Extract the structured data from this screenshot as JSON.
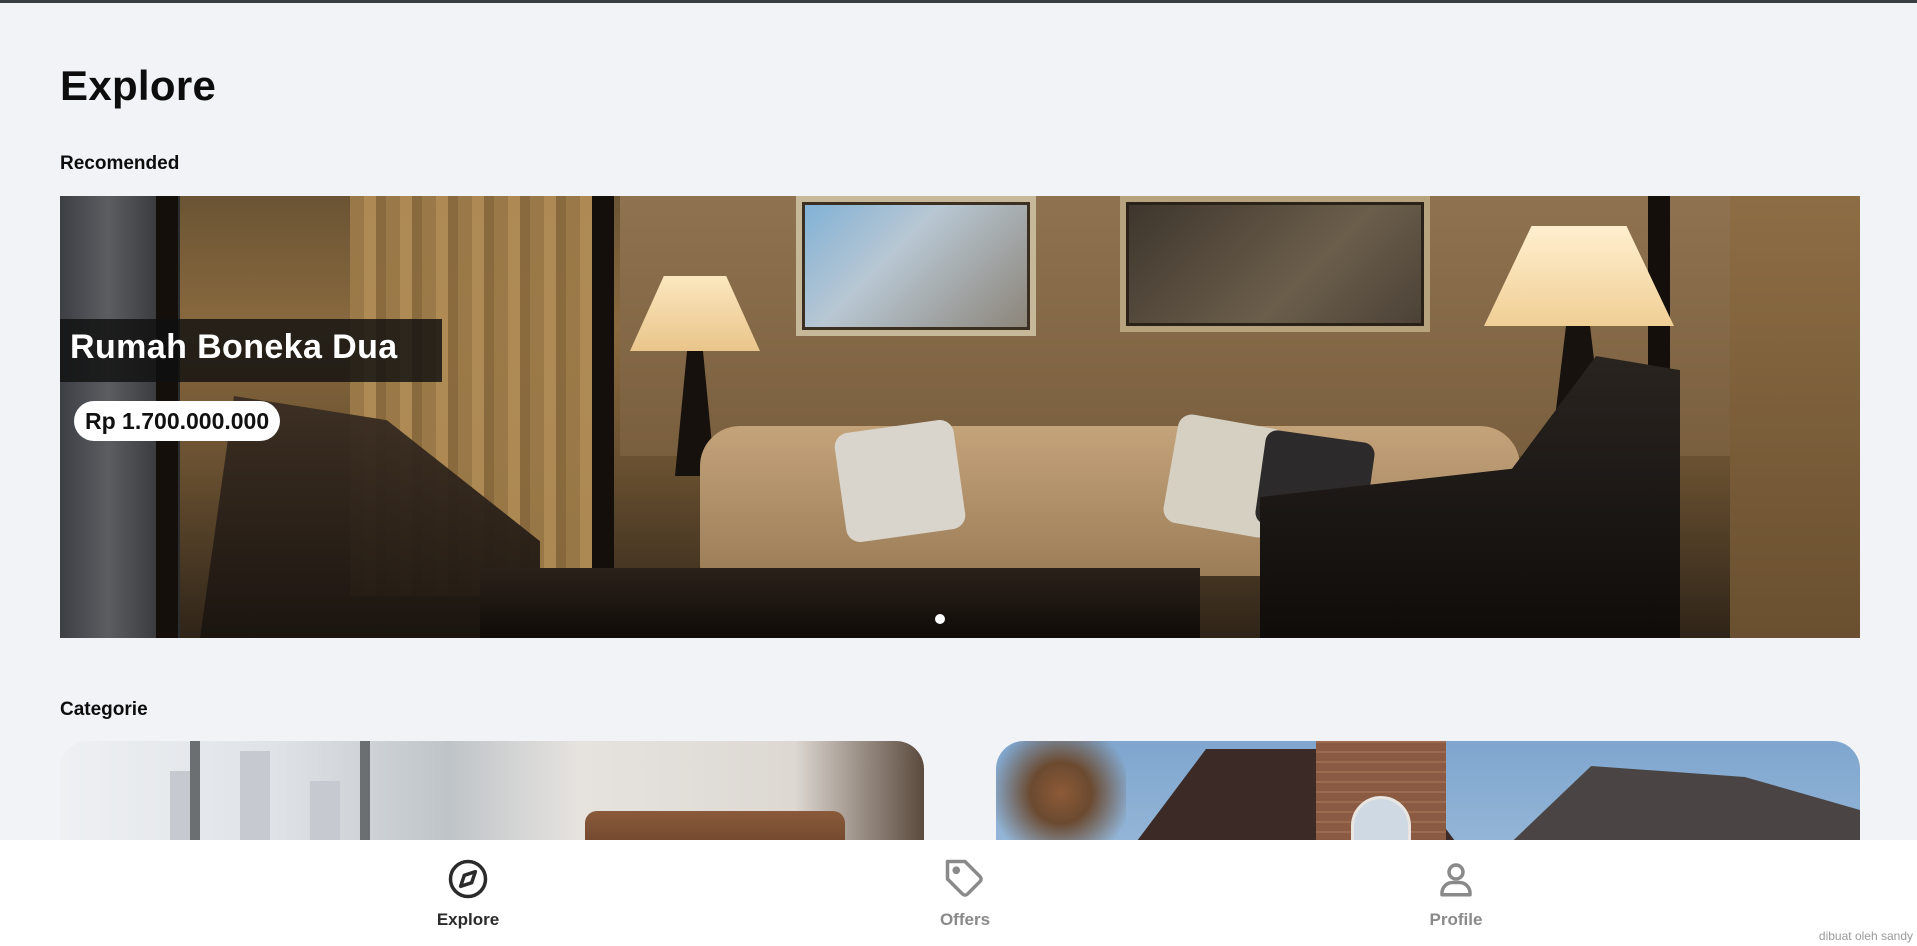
{
  "page": {
    "title": "Explore"
  },
  "sections": {
    "recommended": "Recomended",
    "categories": "Categorie"
  },
  "hero": {
    "title": "Rumah Boneka Dua",
    "price": "Rp 1.700.000.000",
    "carousel_dots": 1,
    "active_dot": 1
  },
  "category_cards": [
    {
      "image": "interior-living-room-photo"
    },
    {
      "image": "house-exterior-roof-photo"
    }
  ],
  "nav": {
    "items": [
      {
        "label": "Explore",
        "icon": "compass-icon",
        "active": true
      },
      {
        "label": "Offers",
        "icon": "tag-icon",
        "active": false
      },
      {
        "label": "Profile",
        "icon": "user-icon",
        "active": false
      }
    ]
  },
  "footer": {
    "credit": "dibuat oleh sandy"
  },
  "colors": {
    "background": "#f2f3f7",
    "nav_active": "#2b2b2b",
    "nav_inactive": "#8a8a8a",
    "text": "#0d0d0d"
  }
}
